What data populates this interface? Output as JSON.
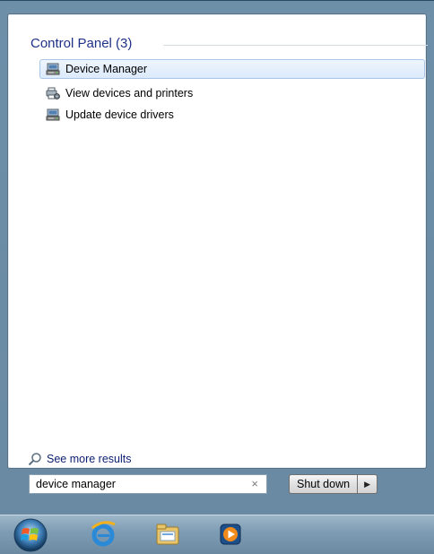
{
  "results": {
    "group_header": "Control Panel (3)",
    "items": [
      {
        "label": "Device Manager",
        "icon": "device-manager-icon",
        "selected": true
      },
      {
        "label": "View devices and printers",
        "icon": "devices-printers-icon",
        "selected": false
      },
      {
        "label": "Update device drivers",
        "icon": "device-manager-icon",
        "selected": false
      }
    ],
    "see_more": "See more results"
  },
  "search": {
    "value": "device manager",
    "clear_glyph": "×"
  },
  "power": {
    "shutdown_label": "Shut down",
    "arrow_glyph": "▶"
  },
  "taskbar": {
    "icons": [
      "start-orb-icon",
      "internet-explorer-icon",
      "windows-explorer-icon",
      "media-player-icon"
    ]
  },
  "colors": {
    "header_text": "#1e3287",
    "selection_border": "#a9c6ea",
    "link_text": "#0b1e70"
  }
}
